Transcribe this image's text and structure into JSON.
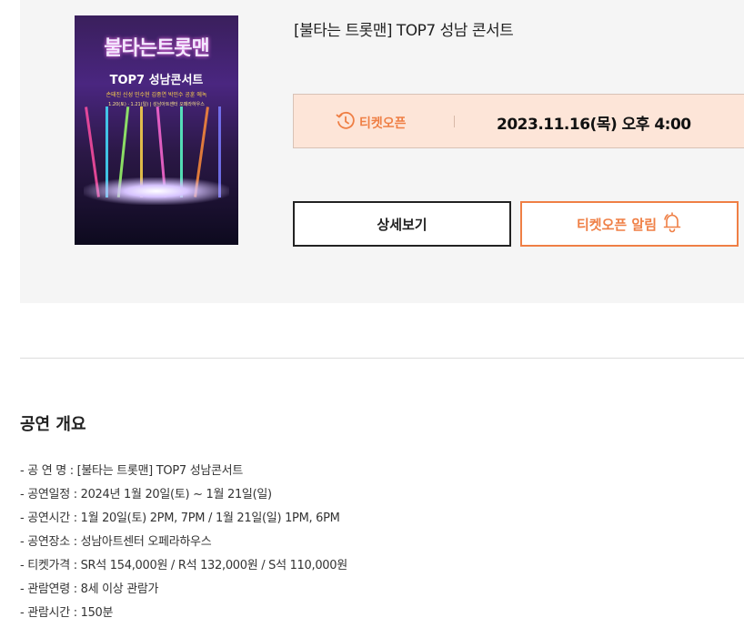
{
  "poster": {
    "title": "불타는트롯맨",
    "subtitle": "TOP7 성남콘서트",
    "cast": "손태진 신성 민수현 김중연 박민수 공훈 에녹",
    "dates": "1.20(토) · 1.21(일) | 성남아트센터 오페라하우스"
  },
  "concert": {
    "title": "[불타는 트롯맨] TOP7 성남 콘서트"
  },
  "ticket_open": {
    "label": "티켓오픈",
    "date": "2023.11.16(목) 오후 4:00"
  },
  "buttons": {
    "detail": "상세보기",
    "alert": "티켓오픈 알림"
  },
  "overview": {
    "heading": "공연 개요",
    "items": [
      "- 공 연 명 : [불타는 트롯맨] TOP7 성남콘서트",
      "- 공연일정 : 2024년 1월 20일(토) ~ 1월 21일(일)",
      "- 공연시간 : 1월 20일(토) 2PM, 7PM / 1월 21일(일) 1PM, 6PM",
      "- 공연장소 : 성남아트센터 오페라하우스",
      "- 티켓가격 : SR석 154,000원 / R석 132,000원 / S석 110,000원",
      "- 관람연령 : 8세 이상 관람가",
      "- 관람시간 : 150분"
    ]
  },
  "colors": {
    "accent": "#ef7f45",
    "open_box_bg": "#fde5d8",
    "panel_bg": "#f5f5f5"
  }
}
